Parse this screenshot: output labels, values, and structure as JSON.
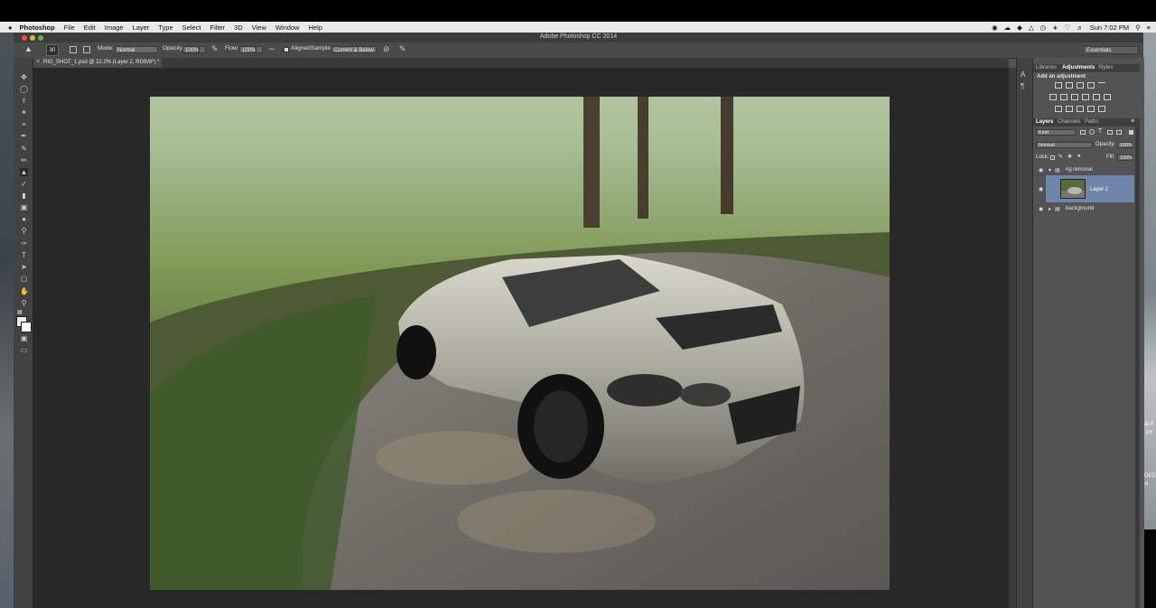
{
  "menubar": {
    "apple": "",
    "app": "Photoshop",
    "items": [
      "File",
      "Edit",
      "Image",
      "Layer",
      "Type",
      "Select",
      "Filter",
      "3D",
      "View",
      "Window",
      "Help"
    ],
    "clock": "Sun 7:02 PM"
  },
  "window": {
    "title": "Adobe Photoshop CC 2014"
  },
  "options": {
    "brush_size": "30",
    "mode_label": "Mode:",
    "mode_value": "Normal",
    "opacity_label": "Opacity:",
    "opacity_value": "100%",
    "flow_label": "Flow:",
    "flow_value": "100%",
    "aligned_label": "Aligned",
    "sample_label": "Sample:",
    "sample_value": "Current & Below",
    "workspace": "Essentials"
  },
  "document": {
    "tab_label": "RIG_SHOT_1.psd @ 22.2% (Layer 2, RGB/8*) *"
  },
  "panels": {
    "top_tabs": [
      "Libraries",
      "Adjustments",
      "Styles"
    ],
    "add_adjustment": "Add an adjustment",
    "layer_tabs": [
      "Layers",
      "Channels",
      "Paths"
    ],
    "kind_value": "Kind",
    "blend_value": "Normal",
    "opacity_label": "Opacity:",
    "opacity_value": "100%",
    "lock_label": "Lock:",
    "fill_label": "Fill:",
    "fill_value": "100%",
    "layers": [
      {
        "name": "rig removal",
        "type": "group",
        "expanded": true
      },
      {
        "name": "Layer 2",
        "type": "pixel",
        "selected": true
      },
      {
        "name": "background",
        "type": "group",
        "expanded": false
      }
    ]
  },
  "desktop_fragments": [
    "al.P",
    ".srt",
    "DED",
    "vi"
  ],
  "colors": {
    "accent_selection": "#6f86aa",
    "panel": "#535353",
    "canvas": "#282828"
  }
}
